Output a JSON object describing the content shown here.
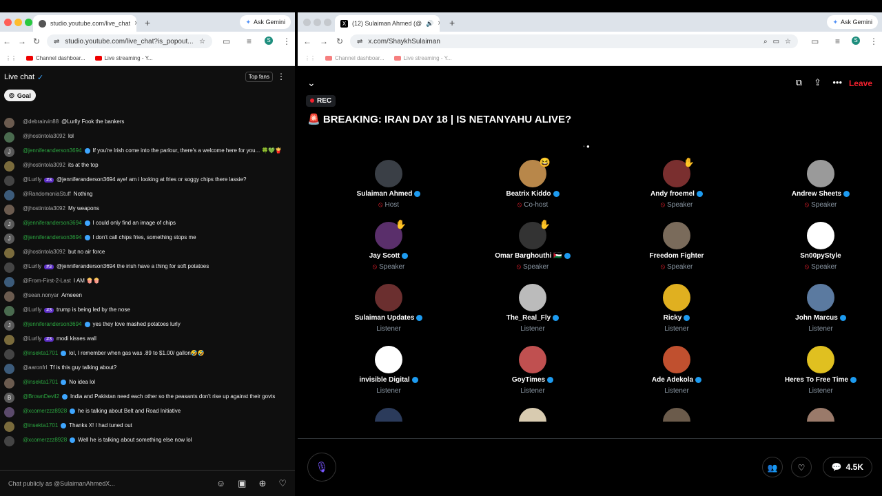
{
  "left_browser": {
    "tab_title": "studio.youtube.com/live_chat",
    "url": "studio.youtube.com/live_chat?is_popout...",
    "ask_gemini": "Ask Gemini",
    "profile_letter": "S",
    "bookmarks": [
      "Channel dashboar...",
      "Live streaming - Y..."
    ]
  },
  "chat": {
    "title": "Live chat",
    "top_fans": "Top fans",
    "goal": "Goal",
    "input_placeholder": "Chat publicly as @SulaimanAhmedX...",
    "messages": [
      {
        "avatar": "",
        "author": "@debrairvin88",
        "text": "@Lurlly Fook the bankers",
        "green": false,
        "badge": "",
        "check": false
      },
      {
        "avatar": "",
        "author": "@jhostintola3092",
        "text": "lol",
        "green": false,
        "badge": "",
        "check": false
      },
      {
        "avatar": "J",
        "author": "@jenniferanderson3694",
        "text": "If you're Irish come into the parlour, there's a welcome here for you... 🍀💚🍟",
        "green": true,
        "badge": "",
        "check": true
      },
      {
        "avatar": "",
        "author": "@jhostintola3092",
        "text": "its at the top",
        "green": false,
        "badge": "",
        "check": false
      },
      {
        "avatar": "",
        "author": "@Lurlly",
        "text": "@jenniferanderson3694 aye! am i looking at fries or soggy chips there lassie?",
        "green": false,
        "badge": "#3",
        "check": false
      },
      {
        "avatar": "",
        "author": "@RandomoniaStuff",
        "text": "Nothing",
        "green": false,
        "badge": "",
        "check": false
      },
      {
        "avatar": "",
        "author": "@jhostintola3092",
        "text": "My weapons",
        "green": false,
        "badge": "",
        "check": false
      },
      {
        "avatar": "J",
        "author": "@jenniferanderson3694",
        "text": "I could only find an image of chips",
        "green": true,
        "badge": "",
        "check": true
      },
      {
        "avatar": "J",
        "author": "@jenniferanderson3694",
        "text": "I don't call chips fries, something stops me",
        "green": true,
        "badge": "",
        "check": true
      },
      {
        "avatar": "",
        "author": "@jhostintola3092",
        "text": "but no air force",
        "green": false,
        "badge": "",
        "check": false
      },
      {
        "avatar": "",
        "author": "@Lurlly",
        "text": "@jenniferanderson3694 the irish have a thing for soft potatoes",
        "green": false,
        "badge": "#3",
        "check": false
      },
      {
        "avatar": "",
        "author": "@From-First-2-Last",
        "text": "I AM 🍿🍿",
        "green": false,
        "badge": "",
        "check": false
      },
      {
        "avatar": "",
        "author": "@sean.nonyar",
        "text": "Ameeen",
        "green": false,
        "badge": "",
        "check": false
      },
      {
        "avatar": "",
        "author": "@Lurlly",
        "text": "trump is being led by the nose",
        "green": false,
        "badge": "#3",
        "check": false
      },
      {
        "avatar": "J",
        "author": "@jenniferanderson3694",
        "text": "yes they love mashed potatoes lurly",
        "green": true,
        "badge": "",
        "check": true
      },
      {
        "avatar": "",
        "author": "@Lurlly",
        "text": "modi kisses wall",
        "green": false,
        "badge": "#3",
        "check": false
      },
      {
        "avatar": "",
        "author": "@insekta1701",
        "text": "lol, I remember when gas was .89 to $1.00/ gallon🤣🤣",
        "green": true,
        "badge": "",
        "check": true
      },
      {
        "avatar": "",
        "author": "@aaronfrl",
        "text": "Tf is this guy talking about?",
        "green": false,
        "badge": "",
        "check": false
      },
      {
        "avatar": "",
        "author": "@insekta1701",
        "text": "No idea lol",
        "green": true,
        "badge": "",
        "check": true
      },
      {
        "avatar": "B",
        "author": "@BrownDevil2",
        "text": "India and Pakistan need each other so the peasants don't rise up against their govts",
        "green": true,
        "badge": "",
        "check": true
      },
      {
        "avatar": "",
        "author": "@xcomerzzz8928",
        "text": "he is talking about Belt and Road Initiative",
        "green": true,
        "badge": "",
        "check": true
      },
      {
        "avatar": "",
        "author": "@insekta1701",
        "text": "Thanks X! I had tuned out",
        "green": true,
        "badge": "",
        "check": true
      },
      {
        "avatar": "",
        "author": "@xcomerzzz8928",
        "text": "Well he is talking about something else now lol",
        "green": true,
        "badge": "",
        "check": true
      }
    ]
  },
  "right_browser": {
    "tab_title": "(12) Sulaiman Ahmed (@",
    "url": "x.com/ShaykhSulaiman",
    "ask_gemini": "Ask Gemini",
    "profile_letter": "S",
    "bookmarks": [
      "Channel dashboar...",
      "Live streaming - Y..."
    ]
  },
  "space": {
    "leave": "Leave",
    "rec": "REC",
    "title": "🚨 BREAKING: IRAN DAY 18 | IS NETANYAHU ALIVE?",
    "count": "4.5K",
    "speakers": [
      {
        "name": "Sulaiman Ahmed",
        "role": "Host",
        "verified": true,
        "hand": ""
      },
      {
        "name": "Beatrix Kiddo",
        "role": "Co-host",
        "verified": true,
        "hand": "😆"
      },
      {
        "name": "Andy froemel",
        "role": "Speaker",
        "verified": true,
        "hand": "✋"
      },
      {
        "name": "Andrew Sheets",
        "role": "Speaker",
        "verified": true,
        "hand": ""
      },
      {
        "name": "Jay Scott",
        "role": "Speaker",
        "verified": true,
        "hand": "✋"
      },
      {
        "name": "Omar Barghouthi 🇵🇸",
        "role": "Speaker",
        "verified": true,
        "hand": "✋"
      },
      {
        "name": "Freedom Fighter",
        "role": "Speaker",
        "verified": false,
        "hand": ""
      },
      {
        "name": "Sn00pyStyle",
        "role": "Speaker",
        "verified": false,
        "hand": ""
      },
      {
        "name": "Sulaiman Updates",
        "role": "Listener",
        "verified": true,
        "hand": ""
      },
      {
        "name": "The_Real_Fly",
        "role": "Listener",
        "verified": true,
        "hand": ""
      },
      {
        "name": "Ricky",
        "role": "Listener",
        "verified": true,
        "hand": ""
      },
      {
        "name": "John Marcus",
        "role": "Listener",
        "verified": true,
        "hand": ""
      },
      {
        "name": "invisible Digital",
        "role": "Listener",
        "verified": true,
        "hand": ""
      },
      {
        "name": "GoyTimes",
        "role": "Listener",
        "verified": true,
        "hand": ""
      },
      {
        "name": "Ade Adekola",
        "role": "Listener",
        "verified": true,
        "hand": ""
      },
      {
        "name": "Heres To Free Time",
        "role": "Listener",
        "verified": true,
        "hand": ""
      }
    ]
  }
}
